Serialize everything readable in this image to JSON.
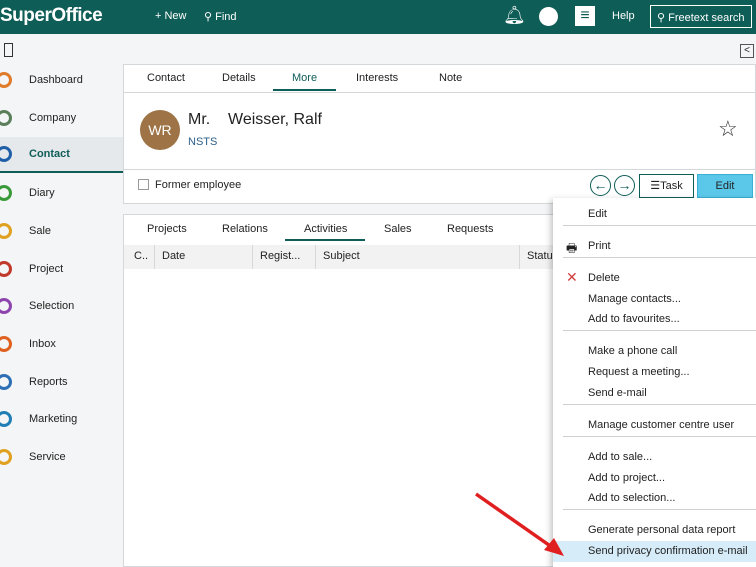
{
  "topbar": {
    "logo": "SuperOffice",
    "new": "New",
    "find": "Find",
    "help": "Help",
    "freetext": "Freetext search"
  },
  "sidebar": {
    "items": [
      {
        "label": "Dashboard",
        "icon": "dashboard-icon",
        "color": "#e07b2a"
      },
      {
        "label": "Company",
        "icon": "company-icon",
        "color": "#5a7d5a"
      },
      {
        "label": "Contact",
        "icon": "contact-icon",
        "color": "#1f5fa8"
      },
      {
        "label": "Diary",
        "icon": "diary-icon",
        "color": "#3a9a3a"
      },
      {
        "label": "Sale",
        "icon": "sale-icon",
        "color": "#e0a020"
      },
      {
        "label": "Project",
        "icon": "project-icon",
        "color": "#c0392b"
      },
      {
        "label": "Selection",
        "icon": "selection-icon",
        "color": "#8e44ad"
      },
      {
        "label": "Inbox",
        "icon": "inbox-icon",
        "color": "#e06020"
      },
      {
        "label": "Reports",
        "icon": "reports-icon",
        "color": "#2c6fb5"
      },
      {
        "label": "Marketing",
        "icon": "marketing-icon",
        "color": "#1f7fb5"
      },
      {
        "label": "Service",
        "icon": "service-icon",
        "color": "#e0a020"
      }
    ]
  },
  "contact_tabs": [
    "Contact",
    "Details",
    "More",
    "Interests",
    "Note"
  ],
  "person": {
    "initials": "WR",
    "title": "Mr.",
    "name": "Weisser, Ralf",
    "company": "NSTS",
    "avatar_color": "#9e7446"
  },
  "former_employee": "Former employee",
  "buttons": {
    "task": "Task",
    "edit": "Edit"
  },
  "activity_tabs": [
    "Projects",
    "Relations",
    "Activities",
    "Sales",
    "Requests"
  ],
  "columns": [
    "C..",
    "Date",
    "Regist...",
    "Subject",
    "Statu"
  ],
  "menu": [
    [
      "Edit"
    ],
    [
      "Print"
    ],
    [
      "Delete",
      "Manage contacts...",
      "Add to favourites..."
    ],
    [
      "Make a phone call",
      "Request a meeting...",
      "Send e-mail"
    ],
    [
      "Manage customer centre user"
    ],
    [
      "Add to sale...",
      "Add to project...",
      "Add to selection..."
    ],
    [
      "Generate personal data report",
      "Send privacy confirmation e-mail"
    ]
  ],
  "colors": {
    "brand": "#0f5d57",
    "edit_button": "#5bc8ea",
    "highlight": "#d6ecf8",
    "arrow": "#e02020"
  }
}
